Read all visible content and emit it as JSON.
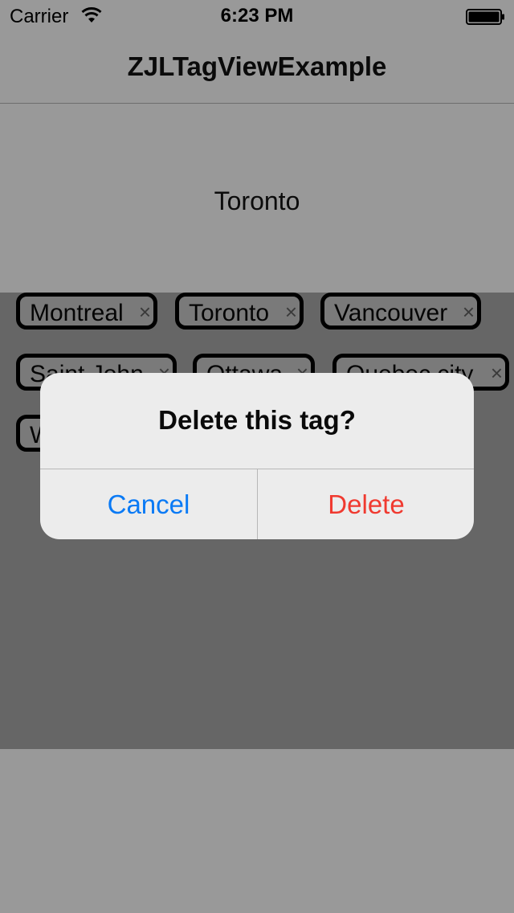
{
  "status_bar": {
    "carrier": "Carrier",
    "time": "6:23 PM",
    "wifi_icon": "wifi-icon",
    "battery_icon": "battery-icon"
  },
  "nav": {
    "title": "ZJLTagViewExample"
  },
  "selected_tag": "Toronto",
  "tags": [
    {
      "label": "Montreal",
      "remove": "×"
    },
    {
      "label": "Toronto",
      "remove": "×"
    },
    {
      "label": "Vancouver",
      "remove": "×"
    },
    {
      "label": "Saint John",
      "remove": "×"
    },
    {
      "label": "Ottawa",
      "remove": "×"
    },
    {
      "label": "Quebec city",
      "remove": "×"
    },
    {
      "label": "W",
      "remove": "×"
    }
  ],
  "alert": {
    "title": "Delete this tag?",
    "cancel_label": "Cancel",
    "delete_label": "Delete"
  },
  "colors": {
    "dimmed_background": "#999999",
    "tag_area_dimmed": "#666666",
    "alert_background": "#ececec",
    "cancel_blue": "#0a7af5",
    "delete_red": "#f03a30"
  }
}
